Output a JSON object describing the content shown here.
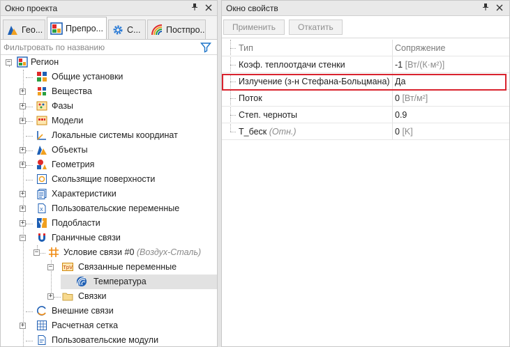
{
  "project_window": {
    "title": "Окно проекта",
    "tabs": [
      {
        "label": "Гео..."
      },
      {
        "label": "Препро..."
      },
      {
        "label": "С..."
      },
      {
        "label": "Постпро..."
      }
    ],
    "filter_placeholder": "Фильтровать по названию",
    "tree": {
      "root": "Регион",
      "items": [
        "Общие установки",
        "Вещества",
        "Фазы",
        "Модели",
        "Локальные системы координат",
        "Объекты",
        "Геометрия",
        "Скользящие поверхности",
        "Характеристики",
        "Пользовательские переменные",
        "Подобласти",
        "Граничные связи"
      ],
      "bc_item": "Условие связи #0",
      "bc_item_sub": "(Воздух-Сталь)",
      "linked_vars": "Связанные переменные",
      "temperature": "Температура",
      "links": "Связки",
      "tail_items": [
        "Внешние связи",
        "Расчетная сетка",
        "Пользовательские модули"
      ]
    }
  },
  "properties_window": {
    "title": "Окно свойств",
    "apply_label": "Применить",
    "rollback_label": "Откатить",
    "header": {
      "name": "Тип",
      "value": "Сопряжение"
    },
    "rows": [
      {
        "name": "Коэф. теплоотдачи стенки",
        "value": "-1",
        "unit": "[Вт/(К·м²)]"
      },
      {
        "name": "Излучение (з-н Стефана-Больцмана)",
        "value": "Да",
        "unit": ""
      },
      {
        "name": "Поток",
        "value": "0",
        "unit": "[Вт/м²]"
      },
      {
        "name": "Степ. черноты",
        "value": "0.9",
        "unit": ""
      },
      {
        "name": "T_беск",
        "name_sub": "(Отн.)",
        "value": "0",
        "unit": "[K]"
      }
    ]
  },
  "colors": {
    "accent": "#1a73c8",
    "highlight": "#d9232e"
  }
}
